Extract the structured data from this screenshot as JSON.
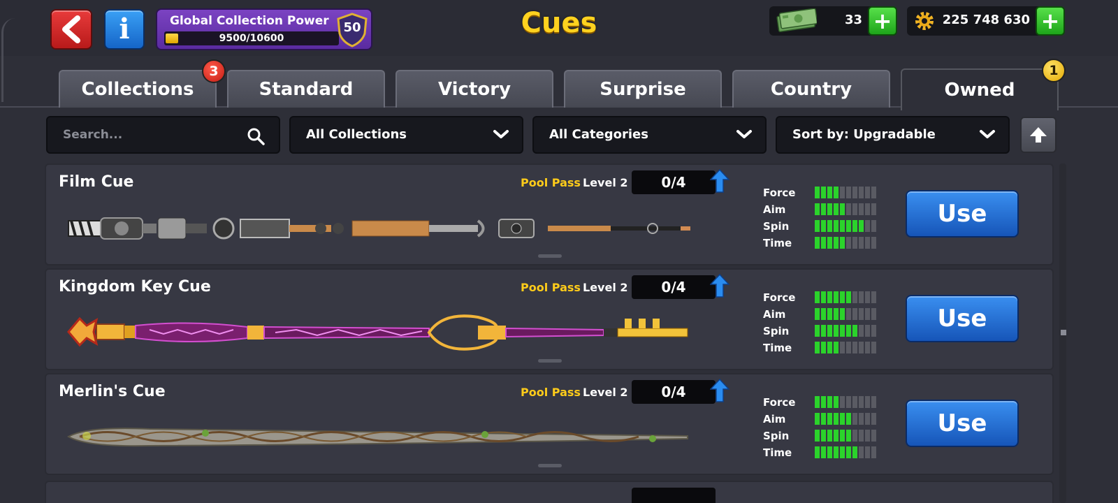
{
  "header": {
    "title": "Cues",
    "collection_power": {
      "label": "Global Collection Power",
      "progress_text": "9500/10600",
      "current": 9500,
      "max": 10600,
      "level": "50"
    },
    "cash": {
      "value": "33",
      "icon": "cash-icon"
    },
    "coins": {
      "value": "225 748 630",
      "icon": "gear-coin-icon"
    }
  },
  "tabs": [
    {
      "label": "Collections",
      "badge": "3",
      "active": false
    },
    {
      "label": "Standard",
      "active": false
    },
    {
      "label": "Victory",
      "active": false
    },
    {
      "label": "Surprise",
      "active": false
    },
    {
      "label": "Country",
      "active": false
    },
    {
      "label": "Owned",
      "badge": "1",
      "active": true
    }
  ],
  "filters": {
    "search_placeholder": "Search...",
    "collections": "All Collections",
    "categories": "All Categories",
    "sort": "Sort by: Upgradable"
  },
  "cues": [
    {
      "name": "Film Cue",
      "pass": "Pool Pass",
      "level": "Level 2",
      "progress": "0/4",
      "stats": [
        {
          "name": "Force",
          "value": 4
        },
        {
          "name": "Aim",
          "value": 5
        },
        {
          "name": "Spin",
          "value": 8
        },
        {
          "name": "Time",
          "value": 5
        }
      ],
      "use_label": "Use"
    },
    {
      "name": "Kingdom Key Cue",
      "pass": "Pool Pass",
      "level": "Level 2",
      "progress": "0/4",
      "stats": [
        {
          "name": "Force",
          "value": 6
        },
        {
          "name": "Aim",
          "value": 5
        },
        {
          "name": "Spin",
          "value": 7
        },
        {
          "name": "Time",
          "value": 4
        }
      ],
      "use_label": "Use"
    },
    {
      "name": "Merlin's Cue",
      "pass": "Pool Pass",
      "level": "Level 2",
      "progress": "0/4",
      "stats": [
        {
          "name": "Force",
          "value": 4
        },
        {
          "name": "Aim",
          "value": 6
        },
        {
          "name": "Spin",
          "value": 6
        },
        {
          "name": "Time",
          "value": 7
        }
      ],
      "use_label": "Use"
    }
  ],
  "colors": {
    "accent_yellow": "#ffd21f",
    "stat_on": "#2bd32b",
    "use_blue": "#1f6fd6",
    "tab_bg": "#4f515c"
  }
}
